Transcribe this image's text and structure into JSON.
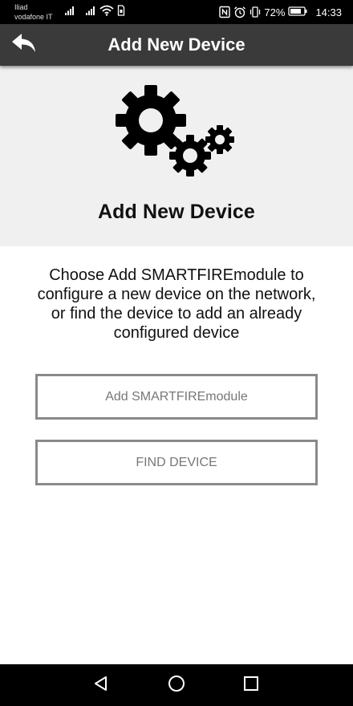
{
  "status_bar": {
    "carrier_line1": "Iliad",
    "carrier_line2": "vodafone IT",
    "battery_percent": "72%",
    "time": "14:33",
    "icons": [
      "signal-icon",
      "signal-icon",
      "wifi-icon",
      "sim-icon",
      "nfc-icon",
      "alarm-icon",
      "vibrate-icon",
      "battery-icon"
    ]
  },
  "app_bar": {
    "title": "Add New Device",
    "back_icon": "back-arrow-icon",
    "background": "#3a3a3a"
  },
  "header": {
    "icon": "gears-icon",
    "title": "Add New Device",
    "background": "#f0f0f0"
  },
  "description": "Choose Add SMARTFIREmodule to configure a new device on the network, or find the device to add an already configured device",
  "buttons": {
    "add_module": "Add SMARTFIREmodule",
    "find_device": "FIND DEVICE"
  },
  "nav_bar": {
    "icons": [
      "nav-back-icon",
      "nav-home-icon",
      "nav-recents-icon"
    ]
  }
}
